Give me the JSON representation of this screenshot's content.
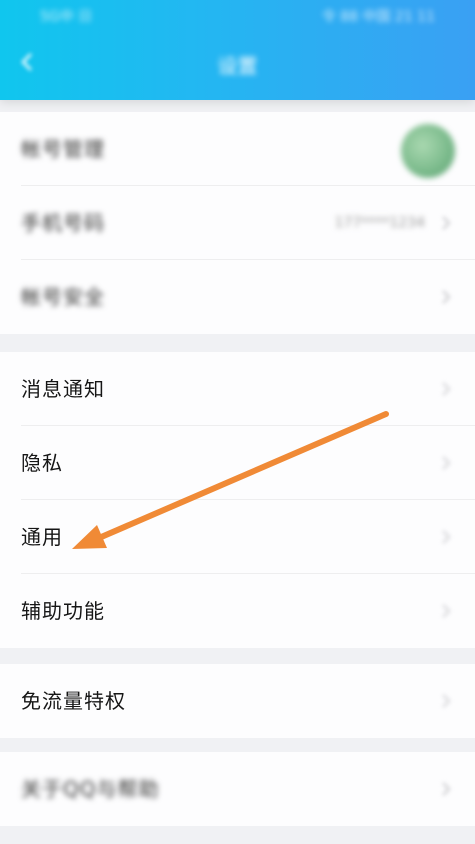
{
  "status_bar": {
    "left": "5G中 日",
    "right": "令 88 中国 21 11"
  },
  "header": {
    "title": "设置",
    "back_icon": "chevron-left-icon"
  },
  "groups": [
    {
      "items": [
        {
          "label": "帐号管理",
          "blurred": true,
          "trailing": "avatar"
        },
        {
          "label": "手机号码",
          "blurred": true,
          "value": "177****1234"
        },
        {
          "label": "帐号安全",
          "blurred": true
        }
      ]
    },
    {
      "items": [
        {
          "label": "消息通知"
        },
        {
          "label": "隐私"
        },
        {
          "label": "通用"
        },
        {
          "label": "辅助功能"
        }
      ]
    },
    {
      "items": [
        {
          "label": "免流量特权"
        }
      ]
    },
    {
      "items": [
        {
          "label": "关于QQ与帮助",
          "blurred": true
        }
      ]
    }
  ],
  "annotation": {
    "color": "#f08a36",
    "points_to": "通用"
  },
  "colors": {
    "header_start": "#10c6ee",
    "header_end": "#3aa0f3",
    "background": "#f0f1f4",
    "arrow": "#f08a36"
  }
}
